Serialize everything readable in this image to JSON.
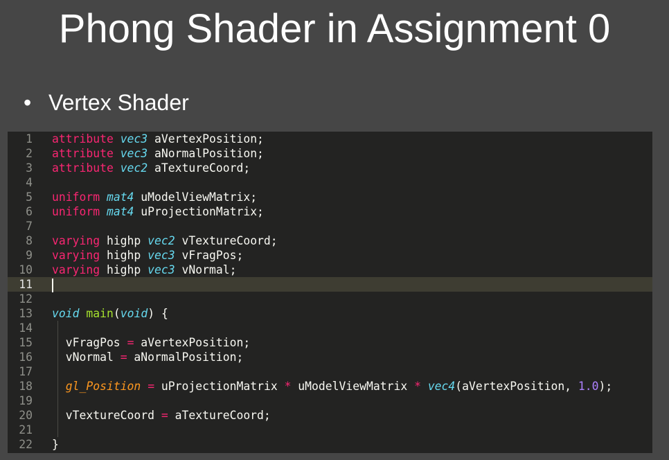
{
  "slide": {
    "title": "Phong Shader in Assignment 0",
    "bullet": "•",
    "bullet_text": "Vertex Shader"
  },
  "colors": {
    "background": "#464646",
    "editor_bg": "#232322",
    "keyword": "#f92672",
    "type": "#66d9ef",
    "function": "#a6e22e",
    "number": "#ae81ff",
    "builtin": "#fd971f",
    "text": "#f8f8f2"
  },
  "editor": {
    "active_line": 11,
    "lines": [
      {
        "n": "1",
        "t": [
          [
            "kw",
            "attribute"
          ],
          [
            "p",
            " "
          ],
          [
            "ty",
            "vec3"
          ],
          [
            "p",
            " aVertexPosition;"
          ]
        ]
      },
      {
        "n": "2",
        "t": [
          [
            "kw",
            "attribute"
          ],
          [
            "p",
            " "
          ],
          [
            "ty",
            "vec3"
          ],
          [
            "p",
            " aNormalPosition;"
          ]
        ]
      },
      {
        "n": "3",
        "t": [
          [
            "kw",
            "attribute"
          ],
          [
            "p",
            " "
          ],
          [
            "ty",
            "vec2"
          ],
          [
            "p",
            " aTextureCoord;"
          ]
        ]
      },
      {
        "n": "4",
        "t": []
      },
      {
        "n": "5",
        "t": [
          [
            "kw",
            "uniform"
          ],
          [
            "p",
            " "
          ],
          [
            "ty",
            "mat4"
          ],
          [
            "p",
            " uModelViewMatrix;"
          ]
        ]
      },
      {
        "n": "6",
        "t": [
          [
            "kw",
            "uniform"
          ],
          [
            "p",
            " "
          ],
          [
            "ty",
            "mat4"
          ],
          [
            "p",
            " uProjectionMatrix;"
          ]
        ]
      },
      {
        "n": "7",
        "t": []
      },
      {
        "n": "8",
        "t": [
          [
            "kw",
            "varying"
          ],
          [
            "p",
            " highp "
          ],
          [
            "ty",
            "vec2"
          ],
          [
            "p",
            " vTextureCoord;"
          ]
        ]
      },
      {
        "n": "9",
        "t": [
          [
            "kw",
            "varying"
          ],
          [
            "p",
            " highp "
          ],
          [
            "ty",
            "vec3"
          ],
          [
            "p",
            " vFragPos;"
          ]
        ]
      },
      {
        "n": "10",
        "t": [
          [
            "kw",
            "varying"
          ],
          [
            "p",
            " highp "
          ],
          [
            "ty",
            "vec3"
          ],
          [
            "p",
            " vNormal;"
          ]
        ]
      },
      {
        "n": "11",
        "t": [
          [
            "cursor",
            ""
          ]
        ]
      },
      {
        "n": "12",
        "t": []
      },
      {
        "n": "13",
        "t": [
          [
            "ty",
            "void"
          ],
          [
            "p",
            " "
          ],
          [
            "fn",
            "main"
          ],
          [
            "p",
            "("
          ],
          [
            "ty",
            "void"
          ],
          [
            "p",
            ") {"
          ]
        ]
      },
      {
        "n": "14",
        "t": []
      },
      {
        "n": "15",
        "t": [
          [
            "p",
            "  vFragPos "
          ],
          [
            "kw",
            "="
          ],
          [
            "p",
            " aVertexPosition;"
          ]
        ]
      },
      {
        "n": "16",
        "t": [
          [
            "p",
            "  vNormal "
          ],
          [
            "kw",
            "="
          ],
          [
            "p",
            " aNormalPosition;"
          ]
        ]
      },
      {
        "n": "17",
        "t": []
      },
      {
        "n": "18",
        "t": [
          [
            "p",
            "  "
          ],
          [
            "var2",
            "gl_Position"
          ],
          [
            "p",
            " "
          ],
          [
            "kw",
            "="
          ],
          [
            "p",
            " uProjectionMatrix "
          ],
          [
            "kw",
            "*"
          ],
          [
            "p",
            " uModelViewMatrix "
          ],
          [
            "kw",
            "*"
          ],
          [
            "p",
            " "
          ],
          [
            "ty",
            "vec4"
          ],
          [
            "p",
            "(aVertexPosition, "
          ],
          [
            "num",
            "1.0"
          ],
          [
            "p",
            ");"
          ]
        ]
      },
      {
        "n": "19",
        "t": []
      },
      {
        "n": "20",
        "t": [
          [
            "p",
            "  vTextureCoord "
          ],
          [
            "kw",
            "="
          ],
          [
            "p",
            " aTextureCoord;"
          ]
        ]
      },
      {
        "n": "21",
        "t": []
      },
      {
        "n": "22",
        "t": [
          [
            "p",
            "}"
          ]
        ]
      }
    ]
  }
}
